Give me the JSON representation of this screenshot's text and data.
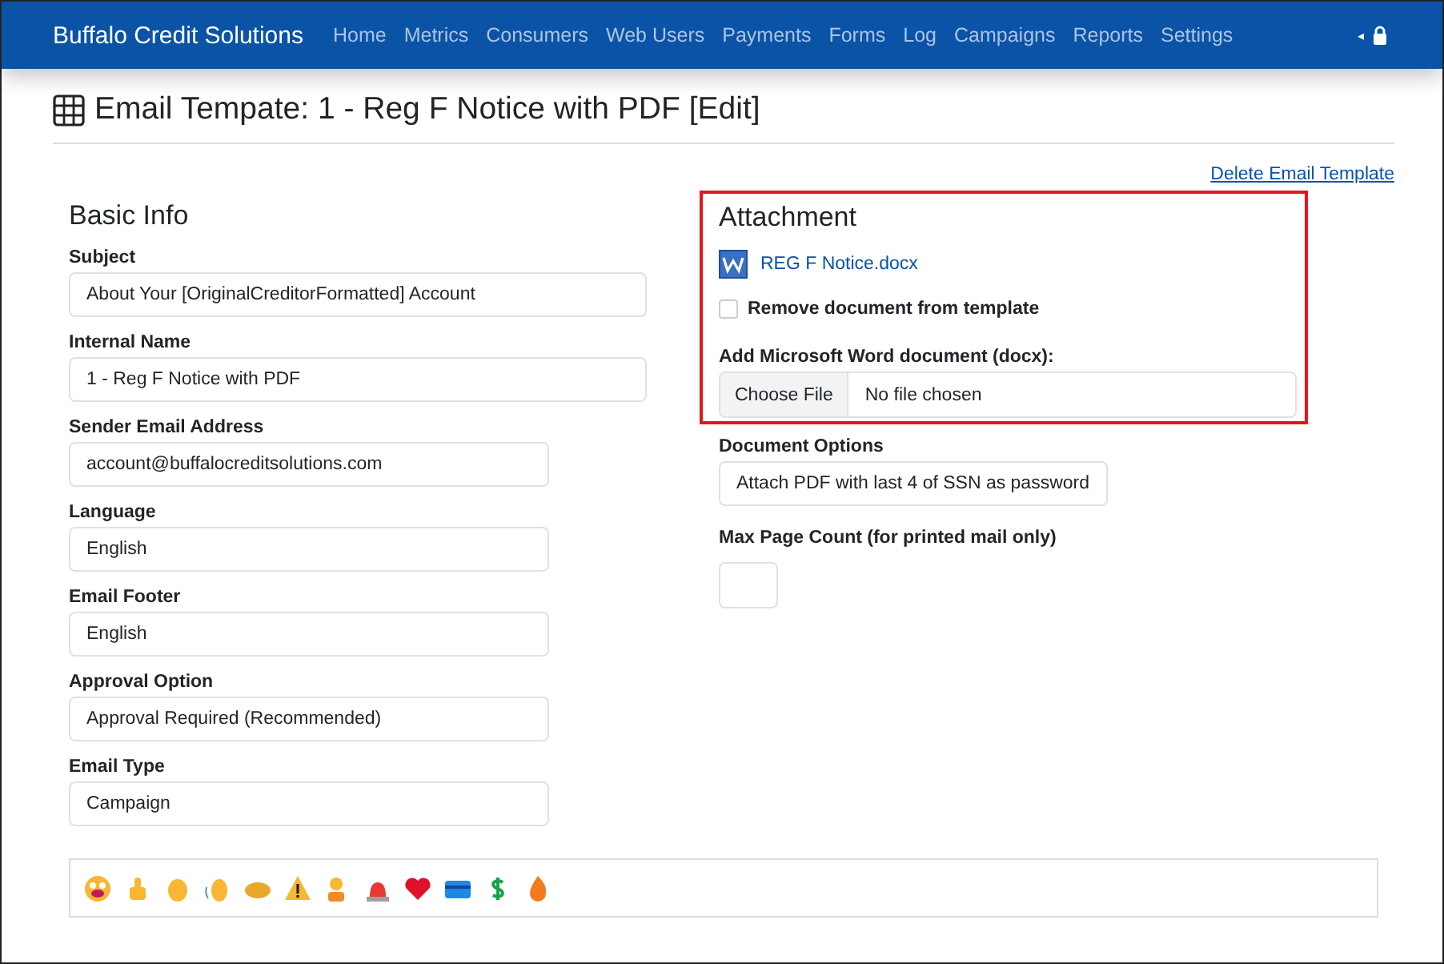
{
  "navbar": {
    "brand": "Buffalo Credit Solutions",
    "links": [
      "Home",
      "Metrics",
      "Consumers",
      "Web Users",
      "Payments",
      "Forms",
      "Log",
      "Campaigns",
      "Reports",
      "Settings"
    ],
    "caret": "◂"
  },
  "page": {
    "title": "Email Tempate: 1 - Reg F Notice with PDF [Edit]",
    "delete_link": "Delete Email Template"
  },
  "basic_info": {
    "heading": "Basic Info",
    "fields": [
      {
        "label": "Subject",
        "value": "About Your [OriginalCreditorFormatted] Account"
      },
      {
        "label": "Internal Name",
        "value": "1 - Reg F Notice with PDF"
      },
      {
        "label": "Sender Email Address",
        "value": "account@buffalocreditsolutions.com"
      },
      {
        "label": "Language",
        "value": "English"
      },
      {
        "label": "Email Footer",
        "value": "English"
      },
      {
        "label": "Approval Option",
        "value": "Approval Required (Recommended)"
      },
      {
        "label": "Email Type",
        "value": "Campaign"
      }
    ]
  },
  "attachment": {
    "heading": "Attachment",
    "file_name": "REG F Notice.docx",
    "remove_label": "Remove document from template",
    "remove_checked": false,
    "upload_label": "Add Microsoft Word document (docx):",
    "choose_button": "Choose File",
    "file_status": "No file chosen"
  },
  "document_options": {
    "label": "Document Options",
    "value": "Attach PDF with last 4 of SSN as password"
  },
  "max_page_count": {
    "label": "Max Page Count (for printed mail only)"
  }
}
